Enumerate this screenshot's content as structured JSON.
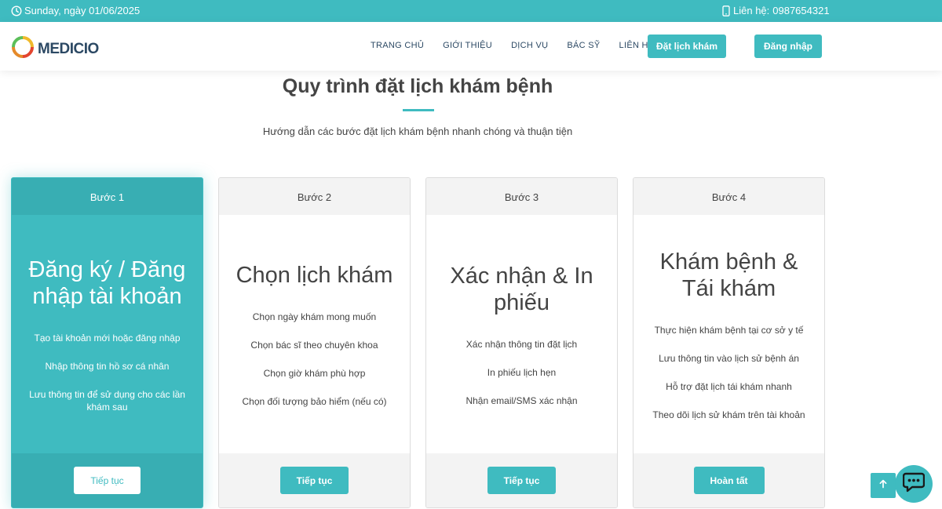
{
  "topbar": {
    "date_text": "Sunday, ngày 01/06/2025",
    "contact_label": "Liên hệ:",
    "contact_phone": "0987654321"
  },
  "header": {
    "logo_text": "MEDICIO",
    "nav": [
      "TRANG CHỦ",
      "GIỚI THIỆU",
      "DỊCH VỤ",
      "BÁC SỸ",
      "LIÊN HỆ"
    ],
    "book_button": "Đặt lịch khám",
    "login_button": "Đăng nhập"
  },
  "section": {
    "title": "Quy trình đặt lịch khám bệnh",
    "subtitle": "Hướng dẫn các bước đặt lịch khám bệnh nhanh chóng và thuận tiện"
  },
  "steps": [
    {
      "label": "Bước 1",
      "title": "Đăng ký / Đăng nhập tài khoản",
      "items": [
        "Tạo tài khoản mới hoặc đăng nhập",
        "Nhập thông tin hồ sơ cá nhân",
        "Lưu thông tin để sử dụng cho các lần khám sau"
      ],
      "button": "Tiếp tục"
    },
    {
      "label": "Bước 2",
      "title": "Chọn lịch khám",
      "items": [
        "Chọn ngày khám mong muốn",
        "Chọn bác sĩ theo chuyên khoa",
        "Chọn giờ khám phù hợp",
        "Chọn đối tượng bảo hiểm (nếu có)"
      ],
      "button": "Tiếp tục"
    },
    {
      "label": "Bước 3",
      "title": "Xác nhận & In phiếu",
      "items": [
        "Xác nhận thông tin đặt lịch",
        "In phiếu lịch hẹn",
        "Nhận email/SMS xác nhận"
      ],
      "button": "Tiếp tục"
    },
    {
      "label": "Bước 4",
      "title": "Khám bệnh & Tái khám",
      "items": [
        "Thực hiện khám bệnh tại cơ sở y tế",
        "Lưu thông tin vào lịch sử bệnh án",
        "Hỗ trợ đặt lịch tái khám nhanh",
        "Theo dõi lịch sử khám trên tài khoản"
      ],
      "button": "Hoàn tất"
    }
  ],
  "icons": {
    "clock": "clock-icon",
    "phone": "phone-icon",
    "logo": "logo-ring-icon",
    "scroll_top": "arrow-up-icon",
    "chat": "chat-icon"
  },
  "colors": {
    "accent": "#3fbbc0",
    "accent_dark": "#38aeb3",
    "nav_text": "#2c4964",
    "text": "#444444"
  }
}
